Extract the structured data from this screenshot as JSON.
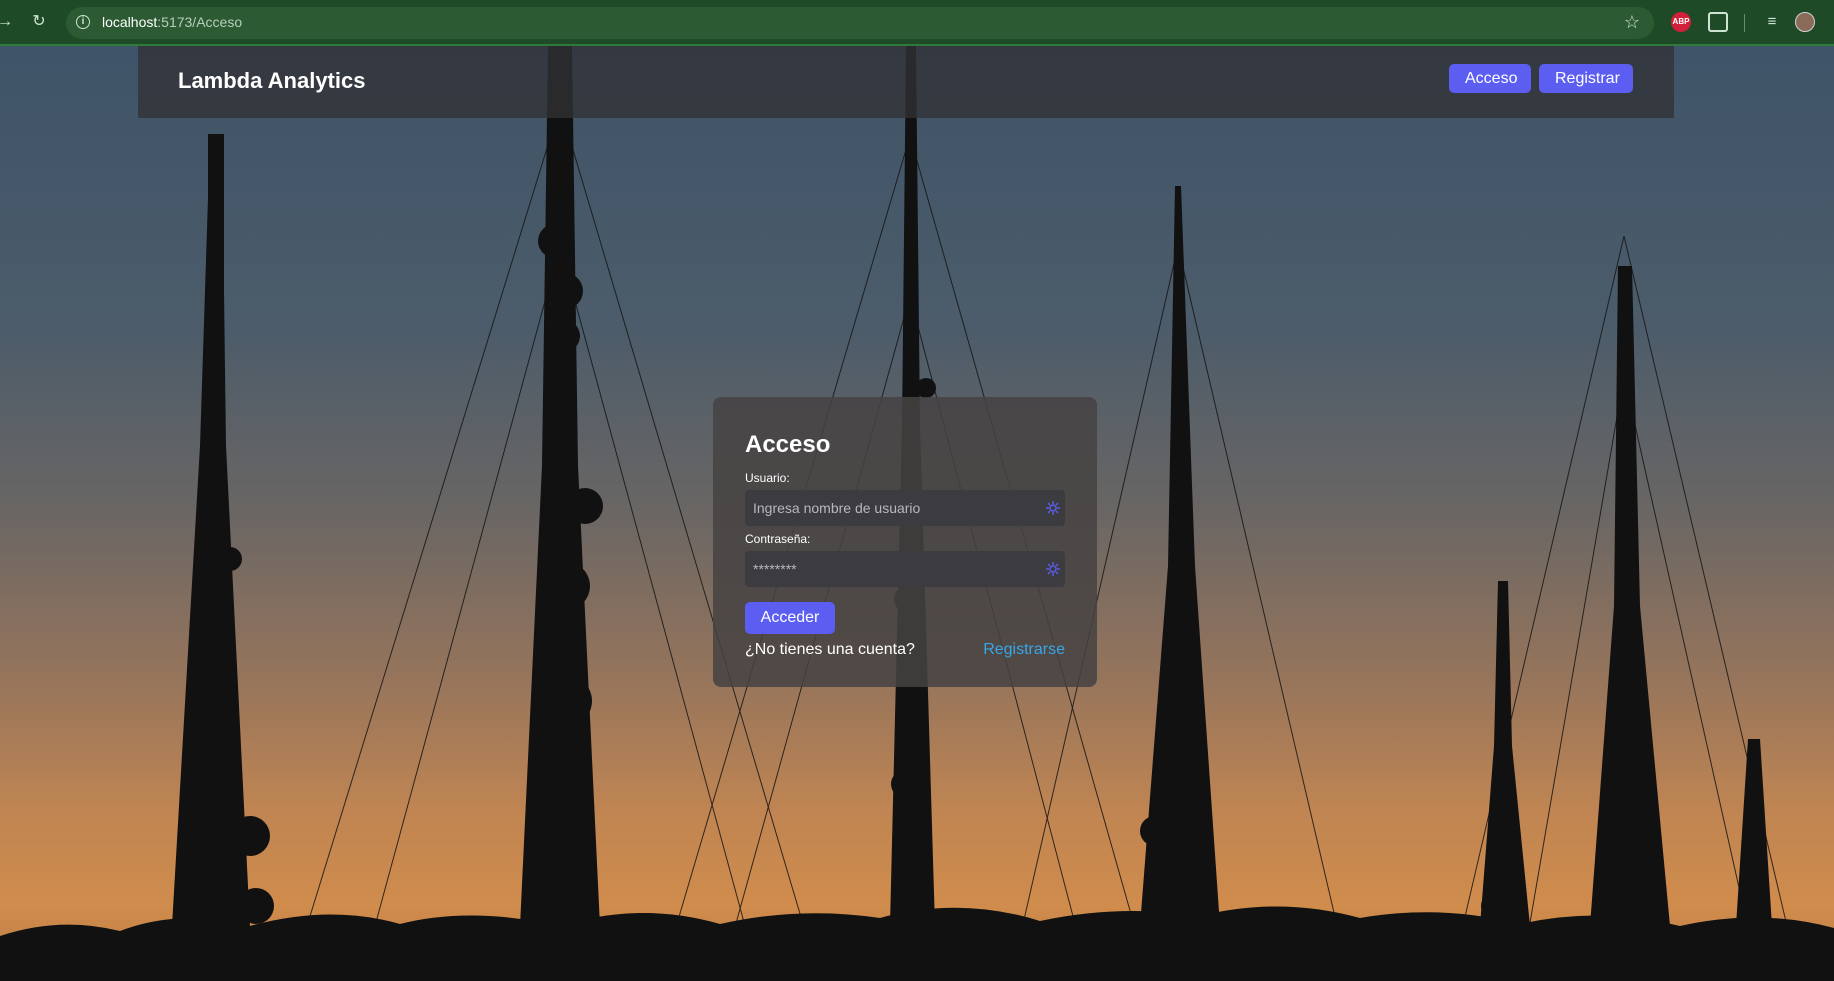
{
  "browser": {
    "url_host": "localhost",
    "url_path": ":5173/Acceso"
  },
  "header": {
    "brand": "Lambda Analytics",
    "nav": {
      "login_label": "Acceso",
      "register_label": "Registrar"
    }
  },
  "login": {
    "title": "Acceso",
    "username_label": "Usuario:",
    "username_placeholder": "Ingresa nombre de usuario",
    "password_label": "Contraseña:",
    "password_placeholder": "********",
    "submit_label": "Acceder",
    "no_account_text": "¿No tienes una cuenta?",
    "register_link": "Registrarse"
  },
  "colors": {
    "accent": "#5b5ef0",
    "link": "#38a6e6"
  }
}
